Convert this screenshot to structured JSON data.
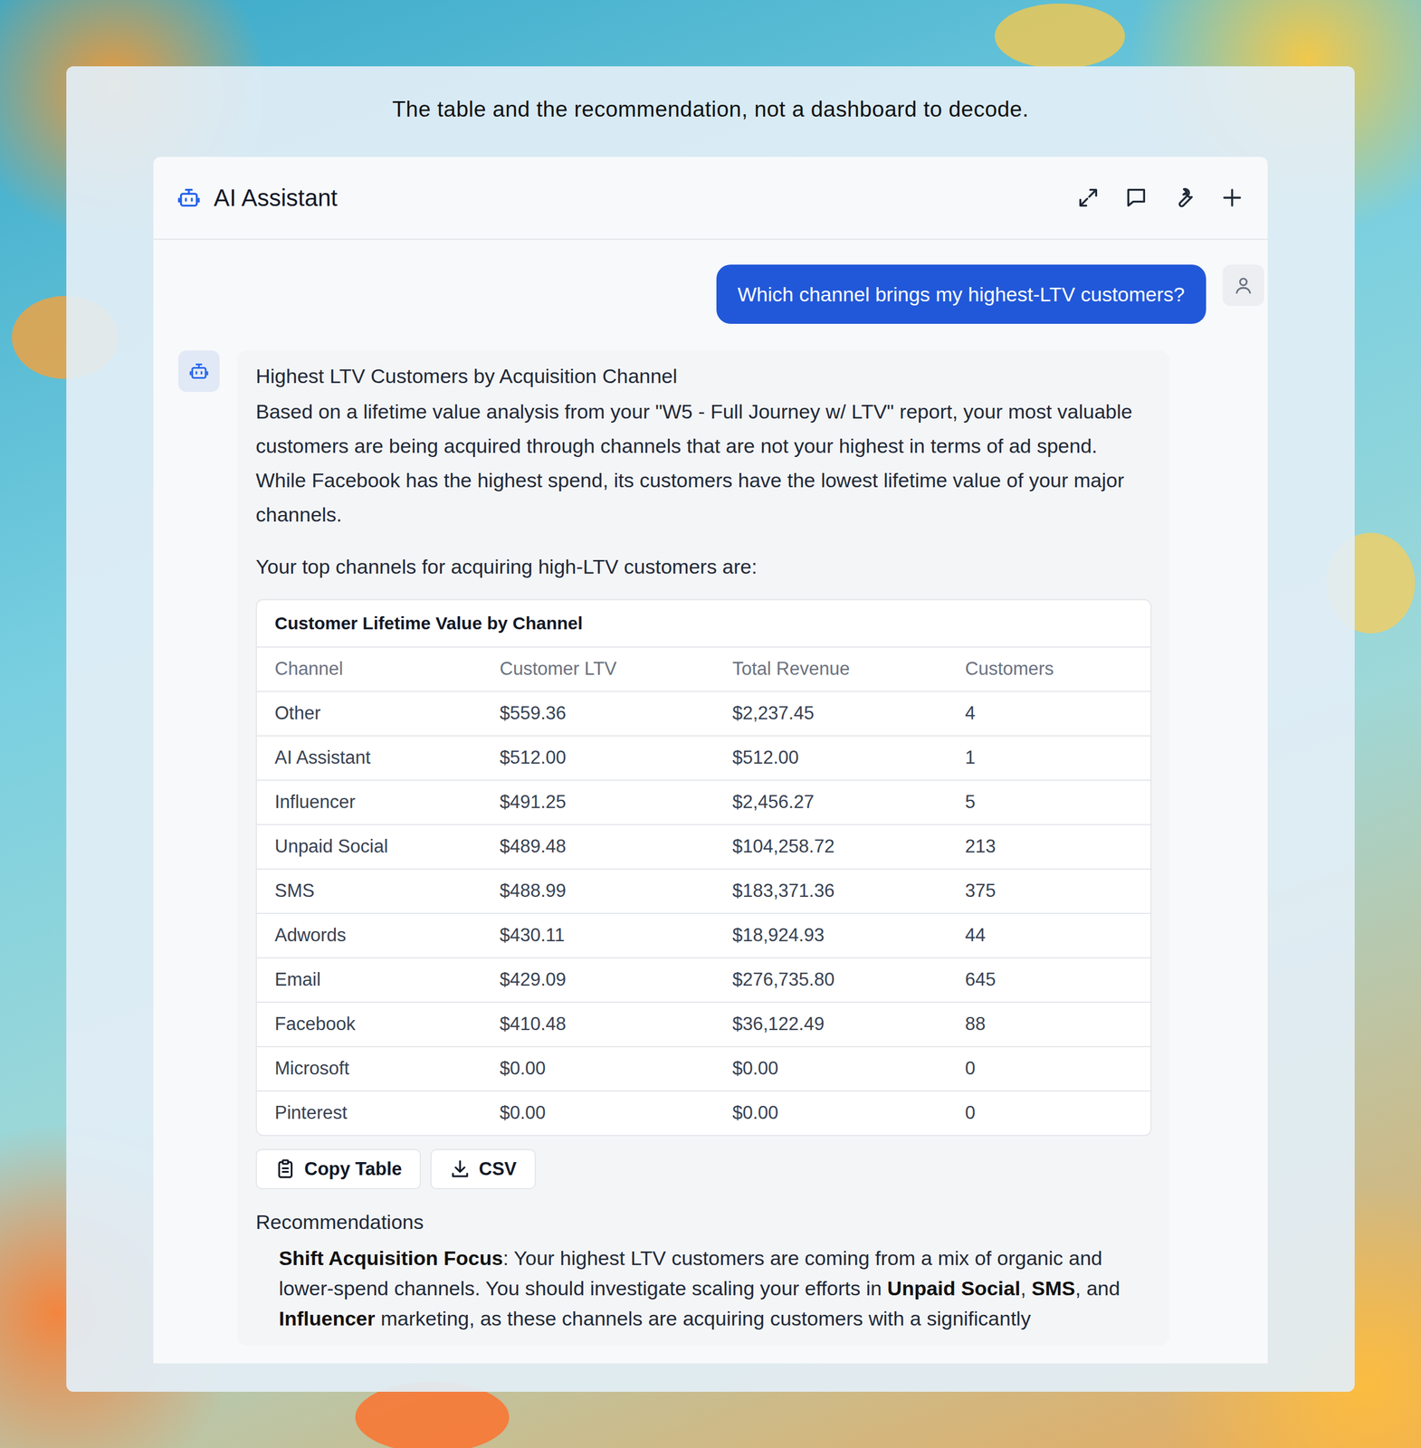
{
  "caption": "The table and the recommendation, not a dashboard to decode.",
  "window": {
    "title": "AI Assistant"
  },
  "user_message": "Which channel brings my highest-LTV customers?",
  "assistant": {
    "heading": "Highest LTV Customers by Acquisition Channel",
    "intro": "Based on a lifetime value analysis from your \"W5 - Full Journey w/ LTV\" report, your most valuable customers are being acquired through channels that are not your highest in terms of ad spend. While Facebook has the highest spend, its customers have the lowest lifetime value of your major channels.",
    "lead_in": "Your top channels for acquiring high-LTV customers are:",
    "table": {
      "title": "Customer Lifetime Value by Channel",
      "columns": [
        "Channel",
        "Customer LTV",
        "Total Revenue",
        "Customers"
      ],
      "rows": [
        [
          "Other",
          "$559.36",
          "$2,237.45",
          "4"
        ],
        [
          "AI Assistant",
          "$512.00",
          "$512.00",
          "1"
        ],
        [
          "Influencer",
          "$491.25",
          "$2,456.27",
          "5"
        ],
        [
          "Unpaid Social",
          "$489.48",
          "$104,258.72",
          "213"
        ],
        [
          "SMS",
          "$488.99",
          "$183,371.36",
          "375"
        ],
        [
          "Adwords",
          "$430.11",
          "$18,924.93",
          "44"
        ],
        [
          "Email",
          "$429.09",
          "$276,735.80",
          "645"
        ],
        [
          "Facebook",
          "$410.48",
          "$36,122.49",
          "88"
        ],
        [
          "Microsoft",
          "$0.00",
          "$0.00",
          "0"
        ],
        [
          "Pinterest",
          "$0.00",
          "$0.00",
          "0"
        ]
      ]
    },
    "buttons": [
      "Copy Table",
      "CSV"
    ],
    "recommendations_heading": "Recommendations",
    "recommendation": [
      {
        "text": "Shift Acquisition Focus",
        "bold": true
      },
      {
        "text": ": Your highest LTV customers are coming from a mix of organic and lower-spend channels. You should investigate scaling your efforts in ",
        "bold": false
      },
      {
        "text": "Unpaid Social",
        "bold": true
      },
      {
        "text": ", ",
        "bold": false
      },
      {
        "text": "SMS",
        "bold": true
      },
      {
        "text": ", and ",
        "bold": false
      },
      {
        "text": "Influencer",
        "bold": true
      },
      {
        "text": " marketing, as these channels are acquiring customers with a significantly",
        "bold": false
      }
    ]
  }
}
